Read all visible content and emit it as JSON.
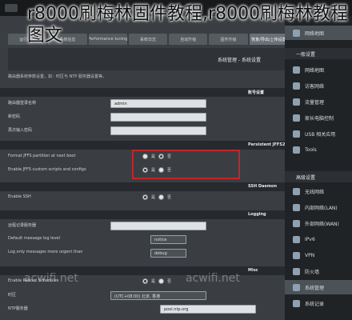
{
  "caption": "r8000刷梅林固件教程,r8000刷梅林教程图文",
  "tabs": [
    "运行状态",
    "系统信息",
    "Performance tuning",
    "系统日志",
    "自动升级",
    "固件升级",
    "恢复/导出/上传设置"
  ],
  "page": {
    "title": "系统管理 - 系统设置",
    "description": "路由器系统参数设置，如：时区与 NTP 服务器设置等。"
  },
  "sections": {
    "account": {
      "header": "账号设置",
      "rows": [
        {
          "label": "路由器登录名称",
          "value": "admin"
        },
        {
          "label": "新密码",
          "value": ""
        },
        {
          "label": "再次输入密码",
          "value": ""
        }
      ]
    },
    "jffs": {
      "header": "Persistent JFFS2 partition",
      "rows": [
        {
          "label": "Format JFFS partition at next boot",
          "radio_yes": "是",
          "radio_no": "否"
        },
        {
          "label": "Enable JFFS custom scripts and configs",
          "radio_yes": "是",
          "radio_no": "否"
        }
      ]
    },
    "ssh": {
      "header": "SSH Daemon",
      "rows": [
        {
          "label": "Enable SSH",
          "radio_yes": "是",
          "radio_no": "否"
        }
      ]
    },
    "logging": {
      "header": "Logging",
      "rows": [
        {
          "label": "远程记录服务器",
          "value": ""
        },
        {
          "label": "Default message log level",
          "value": "notice"
        },
        {
          "label": "Log only messages more urgent than",
          "value": "debug"
        }
      ]
    },
    "misc": {
      "header": "Misc",
      "rows": [
        {
          "label": "Enable Reboot Scheduler",
          "radio_yes": "是",
          "radio_no": "否"
        },
        {
          "label": "时区",
          "value": "(UTC+08:00) 北京, 香港"
        },
        {
          "label": "NTP服务器",
          "value": "pool.ntp.org"
        }
      ]
    }
  },
  "side": {
    "top_label": "网络地图",
    "header_general": "一般设置",
    "items_general": [
      "网络地图",
      "访客网络",
      "流量管理",
      "家长电脑控制",
      "USB 相关应用",
      "Tools"
    ],
    "header_advanced": "高级设置",
    "items_advanced": [
      "无线网络",
      "内部网络(LAN)",
      "外部网络(WAN)",
      "IPv6",
      "VPN",
      "防火墙",
      "系统管理",
      "系统记录"
    ]
  },
  "watermarks": [
    "acwifi.net",
    "acwifi.net"
  ],
  "colors": {
    "highlight": "#c0262c",
    "side_active": "#4c5358"
  }
}
